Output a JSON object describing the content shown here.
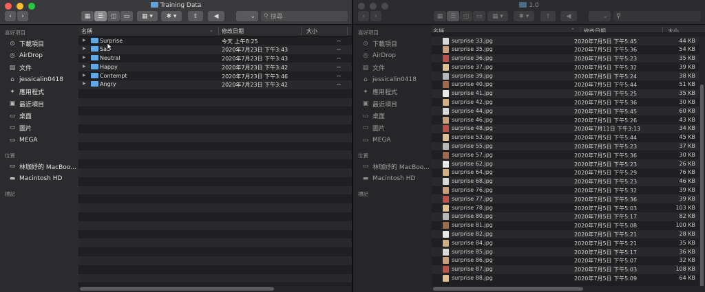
{
  "left_window": {
    "title": "Training Data",
    "search_placeholder": "搜尋",
    "sidebar": {
      "favorites_head": "喜好項目",
      "items": [
        {
          "label": "下載項目",
          "icon": "download-icon"
        },
        {
          "label": "AirDrop",
          "icon": "airdrop-icon"
        },
        {
          "label": "文件",
          "icon": "document-icon"
        },
        {
          "label": "jessicalin0418",
          "icon": "home-icon"
        },
        {
          "label": "應用程式",
          "icon": "applications-icon"
        },
        {
          "label": "最近項目",
          "icon": "recents-icon"
        },
        {
          "label": "桌面",
          "icon": "desktop-icon"
        },
        {
          "label": "圖片",
          "icon": "pictures-icon"
        },
        {
          "label": "MEGA",
          "icon": "folder-icon"
        }
      ],
      "locations_head": "位置",
      "locations": [
        {
          "label": "林珈妤的 MacBoo...",
          "icon": "laptop-icon"
        },
        {
          "label": "Macintosh HD",
          "icon": "disk-icon"
        }
      ],
      "tags_head": "標記"
    },
    "columns": {
      "name": "名稱",
      "date": "修改日期",
      "size": "大小"
    },
    "rows": [
      {
        "name": "Surprise",
        "date": "今天 上午8:25",
        "size": "--"
      },
      {
        "name": "Sad",
        "date": "2020年7月23日 下午3:43",
        "size": "--"
      },
      {
        "name": "Neutral",
        "date": "2020年7月23日 下午3:43",
        "size": "--"
      },
      {
        "name": "Happy",
        "date": "2020年7月23日 下午3:42",
        "size": "--"
      },
      {
        "name": "Contempt",
        "date": "2020年7月23日 下午3:46",
        "size": "--"
      },
      {
        "name": "Angry",
        "date": "2020年7月23日 下午3:42",
        "size": "--"
      }
    ]
  },
  "right_window": {
    "title": "1.0",
    "sidebar": {
      "favorites_head": "喜好項目",
      "items": [
        {
          "label": "下載項目",
          "icon": "download-icon"
        },
        {
          "label": "AirDrop",
          "icon": "airdrop-icon"
        },
        {
          "label": "文件",
          "icon": "document-icon"
        },
        {
          "label": "jessicalin0418",
          "icon": "home-icon"
        },
        {
          "label": "應用程式",
          "icon": "applications-icon"
        },
        {
          "label": "最近項目",
          "icon": "recents-icon"
        },
        {
          "label": "桌面",
          "icon": "desktop-icon"
        },
        {
          "label": "圖片",
          "icon": "pictures-icon"
        },
        {
          "label": "MEGA",
          "icon": "folder-icon"
        }
      ],
      "locations_head": "位置",
      "locations": [
        {
          "label": "林珈妤的 MacBoo...",
          "icon": "laptop-icon"
        },
        {
          "label": "Macintosh HD",
          "icon": "disk-icon"
        }
      ],
      "tags_head": "標記"
    },
    "columns": {
      "name": "名稱",
      "date": "修改日期",
      "size": "大小"
    },
    "rows": [
      {
        "name": "surprise 33.jpg",
        "date": "2020年7月5日 下午5:45",
        "size": "44 KB"
      },
      {
        "name": "surprise 35.jpg",
        "date": "2020年7月5日 下午5:36",
        "size": "54 KB"
      },
      {
        "name": "surprise 36.jpg",
        "date": "2020年7月5日 下午5:23",
        "size": "35 KB"
      },
      {
        "name": "surprise 37.jpg",
        "date": "2020年7月5日 下午5:32",
        "size": "39 KB"
      },
      {
        "name": "surprise 39.jpg",
        "date": "2020年7月5日 下午5:24",
        "size": "38 KB"
      },
      {
        "name": "surprise 40.jpg",
        "date": "2020年7月5日 下午5:44",
        "size": "51 KB"
      },
      {
        "name": "surprise 41.jpg",
        "date": "2020年7月5日 下午5:25",
        "size": "35 KB"
      },
      {
        "name": "surprise 42.jpg",
        "date": "2020年7月5日 下午5:36",
        "size": "30 KB"
      },
      {
        "name": "surprise 44.jpg",
        "date": "2020年7月5日 下午5:45",
        "size": "60 KB"
      },
      {
        "name": "surprise 46.jpg",
        "date": "2020年7月5日 下午5:26",
        "size": "43 KB"
      },
      {
        "name": "surprise 48.jpg",
        "date": "2020年7月11日 下午3:13",
        "size": "34 KB"
      },
      {
        "name": "surprise 53.jpg",
        "date": "2020年7月5日 下午5:44",
        "size": "45 KB"
      },
      {
        "name": "surprise 55.jpg",
        "date": "2020年7月5日 下午5:23",
        "size": "37 KB"
      },
      {
        "name": "surprise 57.jpg",
        "date": "2020年7月5日 下午5:36",
        "size": "30 KB"
      },
      {
        "name": "surprise 62.jpg",
        "date": "2020年7月5日 下午5:23",
        "size": "26 KB"
      },
      {
        "name": "surprise 64.jpg",
        "date": "2020年7月5日 下午5:29",
        "size": "76 KB"
      },
      {
        "name": "surprise 68.jpg",
        "date": "2020年7月5日 下午5:23",
        "size": "46 KB"
      },
      {
        "name": "surprise 76.jpg",
        "date": "2020年7月5日 下午5:32",
        "size": "39 KB"
      },
      {
        "name": "surprise 77.jpg",
        "date": "2020年7月5日 下午5:36",
        "size": "39 KB"
      },
      {
        "name": "surprise 78.jpg",
        "date": "2020年7月5日 下午5:03",
        "size": "103 KB"
      },
      {
        "name": "surprise 80.jpg",
        "date": "2020年7月5日 下午5:17",
        "size": "82 KB"
      },
      {
        "name": "surprise 81.jpg",
        "date": "2020年7月5日 下午5:08",
        "size": "100 KB"
      },
      {
        "name": "surprise 82.jpg",
        "date": "2020年7月5日 下午5:21",
        "size": "28 KB"
      },
      {
        "name": "surprise 84.jpg",
        "date": "2020年7月5日 下午5:21",
        "size": "35 KB"
      },
      {
        "name": "surprise 85.jpg",
        "date": "2020年7月5日 下午5:17",
        "size": "36 KB"
      },
      {
        "name": "surprise 86.jpg",
        "date": "2020年7月5日 下午5:07",
        "size": "32 KB"
      },
      {
        "name": "surprise 87.jpg",
        "date": "2020年7月5日 下午5:03",
        "size": "108 KB"
      },
      {
        "name": "surprise 88.jpg",
        "date": "2020年7月5日 下午5:09",
        "size": "64 KB"
      }
    ]
  }
}
